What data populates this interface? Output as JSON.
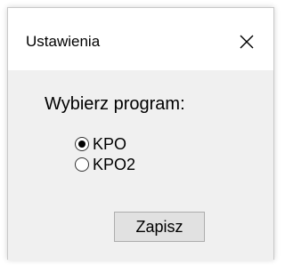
{
  "window": {
    "title": "Ustawienia",
    "close_icon": "close-icon"
  },
  "form": {
    "prompt": "Wybierz program:",
    "options": [
      {
        "label": "KPO",
        "selected": true
      },
      {
        "label": "KPO2",
        "selected": false
      }
    ],
    "save_label": "Zapisz"
  },
  "colors": {
    "client_background": "#f0f0f0",
    "titlebar_background": "#ffffff",
    "button_background": "#e1e1e1",
    "button_border": "#adadad"
  }
}
